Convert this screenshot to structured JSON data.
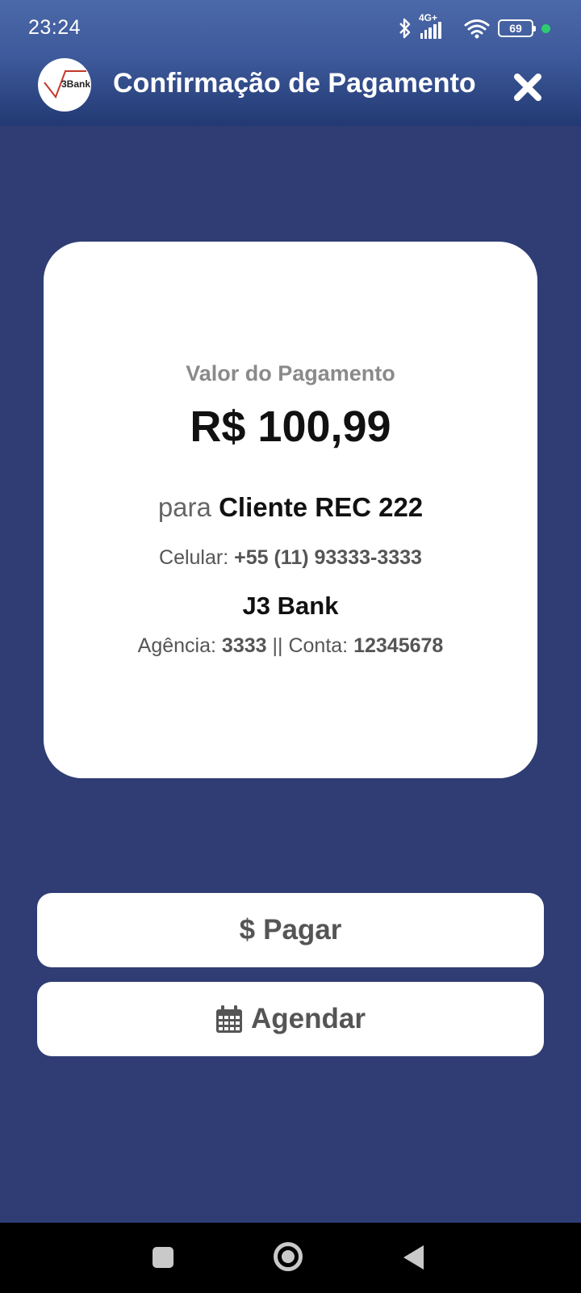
{
  "status_bar": {
    "time": "23:24",
    "network": "4G+",
    "battery": "69",
    "icons": [
      "bluetooth-icon",
      "signal-icon",
      "wifi-icon",
      "battery-icon"
    ]
  },
  "header": {
    "logo_text": "3Bank",
    "title": "Confirmação de Pagamento",
    "close_icon": "close-icon"
  },
  "payment": {
    "label": "Valor do Pagamento",
    "amount": "R$ 100,99",
    "to_prefix": "para",
    "recipient_name": "Cliente REC 222",
    "phone_label": "Celular:",
    "phone": "+55 (11) 93333-3333",
    "bank": "J3 Bank",
    "agency_label": "Agência:",
    "agency": "3333",
    "separator": "||",
    "account_label": "Conta:",
    "account": "12345678"
  },
  "actions": {
    "pay_icon": "$",
    "pay_label": "Pagar",
    "schedule_icon": "calendar-icon",
    "schedule_label": "Agendar"
  },
  "colors": {
    "background": "#2f3d74",
    "header_top": "#4b68a8",
    "header_bottom": "#223973",
    "card": "#ffffff",
    "button_text": "#555555"
  }
}
